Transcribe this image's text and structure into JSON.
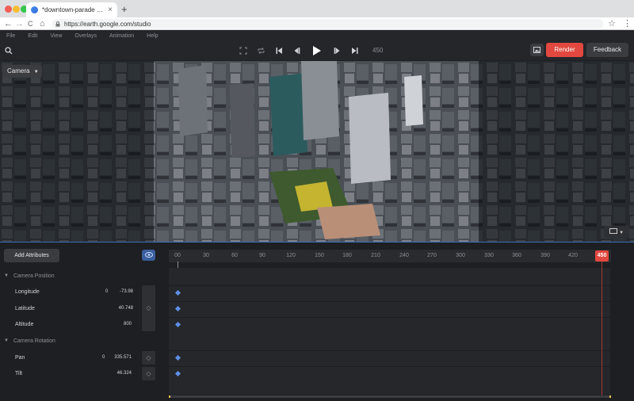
{
  "browser": {
    "tab_title": "*downtown-parade - Google Earth",
    "tab_close": "×",
    "new_tab": "+",
    "url": "https://earth.google.com/studio",
    "nav_back": "←",
    "nav_forward": "→",
    "nav_reload": "C",
    "nav_home": "⌂",
    "star": "☆",
    "menu": "⋮"
  },
  "menubar": [
    "File",
    "Edit",
    "View",
    "Overlays",
    "Animation",
    "Help"
  ],
  "toolbar": {
    "frame_total": "450",
    "render_label": "Render",
    "feedback_label": "Feedback"
  },
  "viewport": {
    "camera_label": "Camera"
  },
  "timeline": {
    "add_attributes_label": "Add Attributes",
    "ticks": [
      "00",
      "30",
      "60",
      "90",
      "120",
      "150",
      "180",
      "210",
      "240",
      "270",
      "300",
      "330",
      "360",
      "390",
      "420"
    ],
    "playhead": "450",
    "groups": [
      {
        "label": "Camera Position",
        "props": [
          {
            "name": "Longitude",
            "prefix": "0",
            "value": "-73.98"
          },
          {
            "name": "Latitude",
            "prefix": "",
            "value": "40.748"
          },
          {
            "name": "Altitude",
            "prefix": "",
            "value": "800"
          }
        ]
      },
      {
        "label": "Camera Rotation",
        "props": [
          {
            "name": "Pan",
            "prefix": "0",
            "value": "335.571"
          },
          {
            "name": "Tilt",
            "prefix": "",
            "value": "46.324"
          }
        ]
      }
    ]
  },
  "colors": {
    "accent": "#e2483f",
    "keyframe": "#5d8fe6",
    "toggle": "#3b5f9e"
  }
}
